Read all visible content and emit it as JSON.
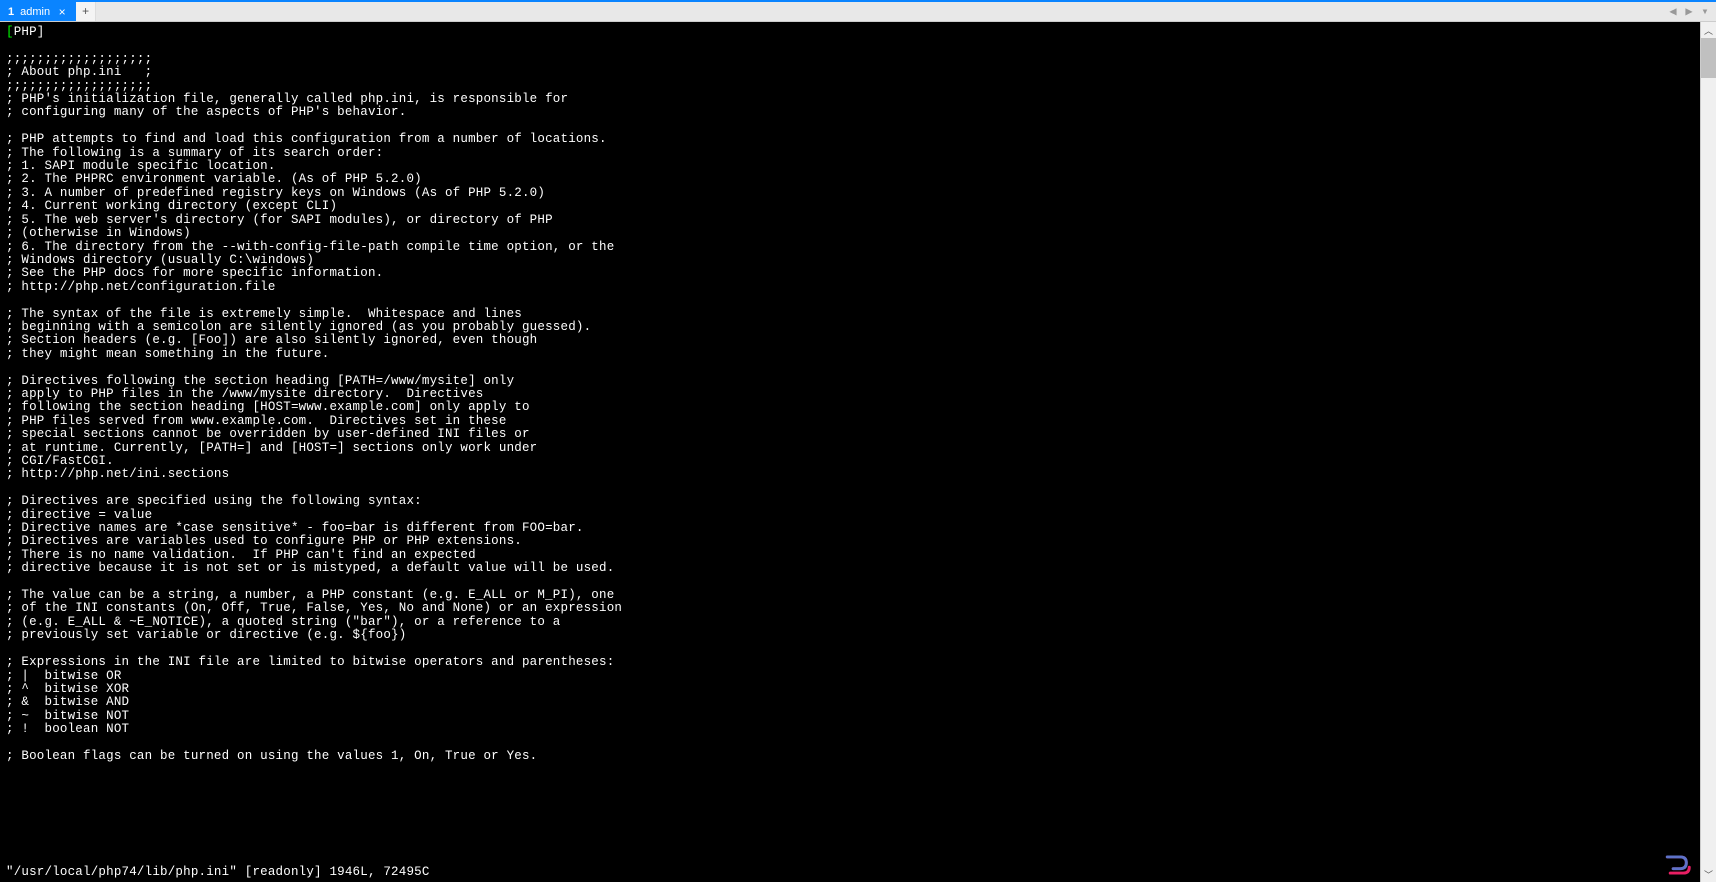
{
  "tab": {
    "number": "1",
    "title": "admin",
    "close_glyph": "×",
    "add_glyph": "+"
  },
  "nav": {
    "left_glyph": "◀",
    "right_glyph": "▶",
    "down_glyph": "▾"
  },
  "scroll": {
    "up_glyph": "︿",
    "down_glyph": "﹀"
  },
  "editor": {
    "cursor_char": "[",
    "section_header": "PHP]",
    "body": ";;;;;;;;;;;;;;;;;;;\n; About php.ini   ;\n;;;;;;;;;;;;;;;;;;;\n; PHP's initialization file, generally called php.ini, is responsible for\n; configuring many of the aspects of PHP's behavior.\n\n; PHP attempts to find and load this configuration from a number of locations.\n; The following is a summary of its search order:\n; 1. SAPI module specific location.\n; 2. The PHPRC environment variable. (As of PHP 5.2.0)\n; 3. A number of predefined registry keys on Windows (As of PHP 5.2.0)\n; 4. Current working directory (except CLI)\n; 5. The web server's directory (for SAPI modules), or directory of PHP\n; (otherwise in Windows)\n; 6. The directory from the --with-config-file-path compile time option, or the\n; Windows directory (usually C:\\windows)\n; See the PHP docs for more specific information.\n; http://php.net/configuration.file\n\n; The syntax of the file is extremely simple.  Whitespace and lines\n; beginning with a semicolon are silently ignored (as you probably guessed).\n; Section headers (e.g. [Foo]) are also silently ignored, even though\n; they might mean something in the future.\n\n; Directives following the section heading [PATH=/www/mysite] only\n; apply to PHP files in the /www/mysite directory.  Directives\n; following the section heading [HOST=www.example.com] only apply to\n; PHP files served from www.example.com.  Directives set in these\n; special sections cannot be overridden by user-defined INI files or\n; at runtime. Currently, [PATH=] and [HOST=] sections only work under\n; CGI/FastCGI.\n; http://php.net/ini.sections\n\n; Directives are specified using the following syntax:\n; directive = value\n; Directive names are *case sensitive* - foo=bar is different from FOO=bar.\n; Directives are variables used to configure PHP or PHP extensions.\n; There is no name validation.  If PHP can't find an expected\n; directive because it is not set or is mistyped, a default value will be used.\n\n; The value can be a string, a number, a PHP constant (e.g. E_ALL or M_PI), one\n; of the INI constants (On, Off, True, False, Yes, No and None) or an expression\n; (e.g. E_ALL & ~E_NOTICE), a quoted string (\"bar\"), or a reference to a\n; previously set variable or directive (e.g. ${foo})\n\n; Expressions in the INI file are limited to bitwise operators and parentheses:\n; |  bitwise OR\n; ^  bitwise XOR\n; &  bitwise AND\n; ~  bitwise NOT\n; !  boolean NOT\n\n; Boolean flags can be turned on using the values 1, On, True or Yes.",
    "status_line": "\"/usr/local/php74/lib/php.ini\" [readonly] 1946L, 72495C"
  }
}
